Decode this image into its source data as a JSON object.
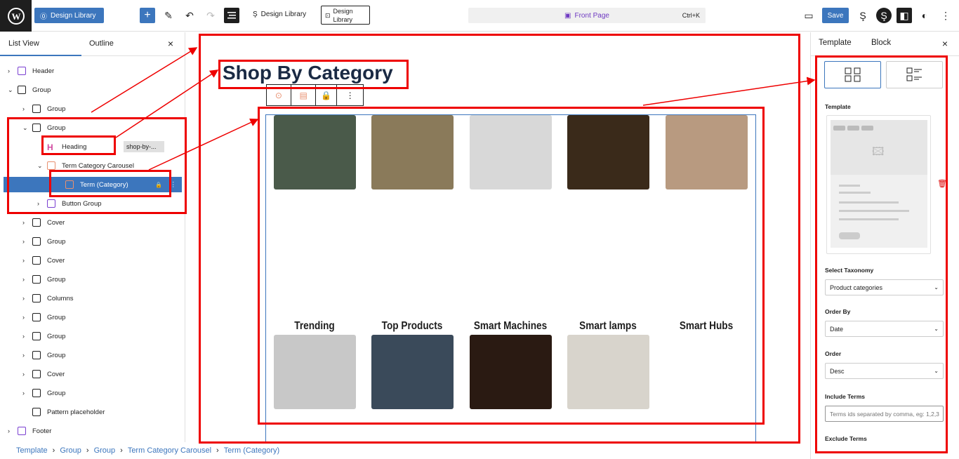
{
  "topbar": {
    "site_label": "Design Library",
    "breadcrumb_title": "Design Library",
    "library_button": "Design Library",
    "page_name": "Front Page",
    "shortcut": "Ctrl+K",
    "save_label": "Save"
  },
  "left_panel": {
    "tabs": [
      "List View",
      "Outline"
    ],
    "items": [
      {
        "label": "Header",
        "indent": 0,
        "chev": "›",
        "icon": "header-icon"
      },
      {
        "label": "Group",
        "indent": 0,
        "chev": "⌄",
        "icon": "group-icon"
      },
      {
        "label": "Group",
        "indent": 1,
        "chev": "›",
        "icon": "group-icon"
      },
      {
        "label": "Group",
        "indent": 1,
        "chev": "⌄",
        "icon": "group-icon"
      },
      {
        "label": "Heading",
        "indent": 2,
        "chev": "",
        "icon": "heading-icon",
        "tag": "shop-by-..."
      },
      {
        "label": "Term Category Carousel",
        "indent": 2,
        "chev": "⌄",
        "icon": "carousel-icon"
      },
      {
        "label": "Term (Category)",
        "indent": 3,
        "chev": "",
        "icon": "term-icon",
        "selected": true
      },
      {
        "label": "Button Group",
        "indent": 2,
        "chev": "›",
        "icon": "button-group-icon"
      },
      {
        "label": "Cover",
        "indent": 1,
        "chev": "›",
        "icon": "cover-icon"
      },
      {
        "label": "Group",
        "indent": 1,
        "chev": "›",
        "icon": "group-icon"
      },
      {
        "label": "Cover",
        "indent": 1,
        "chev": "›",
        "icon": "cover-icon"
      },
      {
        "label": "Group",
        "indent": 1,
        "chev": "›",
        "icon": "group-icon"
      },
      {
        "label": "Columns",
        "indent": 1,
        "chev": "›",
        "icon": "columns-icon"
      },
      {
        "label": "Group",
        "indent": 1,
        "chev": "›",
        "icon": "group-icon"
      },
      {
        "label": "Group",
        "indent": 1,
        "chev": "›",
        "icon": "group-icon"
      },
      {
        "label": "Group",
        "indent": 1,
        "chev": "›",
        "icon": "group-icon"
      },
      {
        "label": "Cover",
        "indent": 1,
        "chev": "›",
        "icon": "cover-icon"
      },
      {
        "label": "Group",
        "indent": 1,
        "chev": "›",
        "icon": "group-icon"
      },
      {
        "label": "Pattern placeholder",
        "indent": 1,
        "chev": "",
        "icon": "pattern-icon"
      },
      {
        "label": "Footer",
        "indent": 0,
        "chev": "›",
        "icon": "footer-icon"
      }
    ]
  },
  "canvas": {
    "heading": "Shop By Category",
    "categories": [
      {
        "name": "Trending",
        "color": "#4a5a4a"
      },
      {
        "name": "Top Products",
        "color": "#8a7a5a"
      },
      {
        "name": "Smart Machines",
        "color": "#d8d8d8"
      },
      {
        "name": "Smart lamps",
        "color": "#3a2a1a"
      },
      {
        "name": "Smart Hubs",
        "color": "#b89a80"
      }
    ],
    "row2_colors": [
      "#c8c8c8",
      "#3a4a5a",
      "#2a1a12",
      "#d8d4cc"
    ]
  },
  "right_panel": {
    "tabs": [
      "Template",
      "Block"
    ],
    "template_label": "Template",
    "taxonomy_label": "Select Taxonomy",
    "taxonomy_value": "Product categories",
    "order_by_label": "Order By",
    "order_by_value": "Date",
    "order_label": "Order",
    "order_value": "Desc",
    "include_label": "Include Terms",
    "include_placeholder": "Terms ids separated by comma, eg: 1,2,3",
    "exclude_label": "Exclude Terms"
  },
  "breadcrumbs": [
    "Template",
    "Group",
    "Group",
    "Term Category Carousel",
    "Term (Category)"
  ]
}
